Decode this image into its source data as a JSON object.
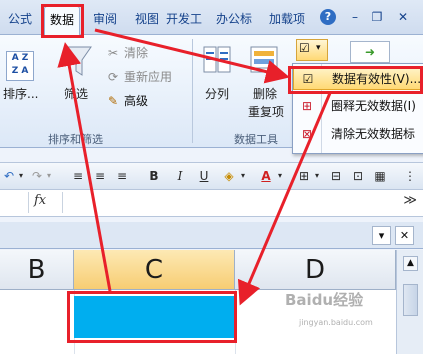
{
  "tabs": [
    {
      "label": "公式",
      "active": false
    },
    {
      "label": "数据",
      "active": true
    },
    {
      "label": "审阅",
      "active": false
    },
    {
      "label": "视图",
      "active": false
    },
    {
      "label": "开发工",
      "active": false
    },
    {
      "label": "办公标",
      "active": false
    },
    {
      "label": "加载项",
      "active": false
    }
  ],
  "window_controls": {
    "help": "?",
    "minimize": "–",
    "restore": "❐",
    "close": "✕"
  },
  "ribbon": {
    "sort": {
      "az_top": "A Z",
      "az_bottom": "Z A",
      "label": "排序..."
    },
    "filter": {
      "label": "筛选"
    },
    "clear": {
      "label": "清除"
    },
    "reapply": {
      "label": "重新应用"
    },
    "advanced": {
      "label": "高级"
    },
    "sort_filter_group": "排序和筛选",
    "text_to_columns": {
      "label": "分列"
    },
    "remove_duplicates": {
      "label_line1": "删除",
      "label_line2": "重复项"
    },
    "data_tools_group": "数据工具"
  },
  "dropdown_menu": {
    "items": [
      {
        "label": "数据有效性(V)...",
        "highlighted": true
      },
      {
        "label": "圈释无效数据(I)",
        "highlighted": false
      },
      {
        "label": "清除无效数据标",
        "highlighted": false
      }
    ]
  },
  "format_toolbar": {
    "bold": "B",
    "italic": "I",
    "underline": "U",
    "font_color_letter": "A"
  },
  "formula_bar": {
    "fx": "fx",
    "value": "",
    "expand": "≫"
  },
  "sheet_controls": {
    "dropdown": "▾",
    "close": "✕"
  },
  "columns": [
    {
      "label": "B",
      "selected": false
    },
    {
      "label": "C",
      "selected": true
    },
    {
      "label": "D",
      "selected": false
    }
  ],
  "colors": {
    "annotation_red": "#e8202a",
    "selected_cell": "#00aeef",
    "menu_highlight": "#ffd975"
  },
  "watermark": {
    "brand": "Baidu经验",
    "url": "jingyan.baidu.com"
  }
}
